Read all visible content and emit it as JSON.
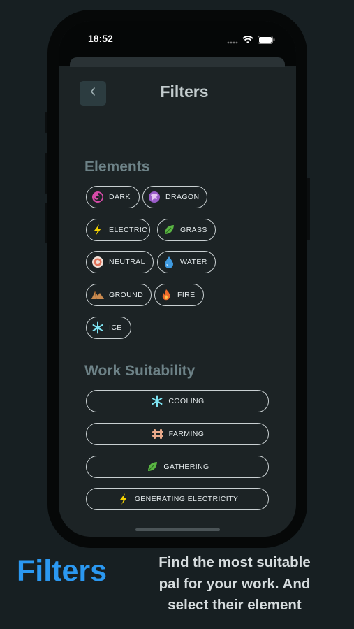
{
  "status_bar": {
    "time": "18:52"
  },
  "header": {
    "title": "Filters"
  },
  "elements": {
    "title": "Elements",
    "items": [
      {
        "label": "DARK",
        "icon": "dark-swirl-icon",
        "color": "#d64aa8"
      },
      {
        "label": "DRAGON",
        "icon": "dragon-icon",
        "color": "#9a5cc9"
      },
      {
        "label": "ELECTRIC",
        "icon": "lightning-icon",
        "color": "#f4d200"
      },
      {
        "label": "GRASS",
        "icon": "leaf-icon",
        "color": "#5ab543"
      },
      {
        "label": "NEUTRAL",
        "icon": "neutral-target-icon",
        "color": "#e8b7a8"
      },
      {
        "label": "WATER",
        "icon": "water-drop-icon",
        "color": "#3f9ae0"
      },
      {
        "label": "GROUND",
        "icon": "ground-icon",
        "color": "#c98a4f"
      },
      {
        "label": "FIRE",
        "icon": "flame-icon",
        "color": "#ef6a2b"
      },
      {
        "label": "ICE",
        "icon": "snowflake-icon",
        "color": "#7ee3f2"
      }
    ]
  },
  "work": {
    "title": "Work Suitability",
    "items": [
      {
        "label": "COOLING",
        "icon": "snowflake-icon"
      },
      {
        "label": "FARMING",
        "icon": "farming-fence-icon"
      },
      {
        "label": "GATHERING",
        "icon": "leaf-icon"
      },
      {
        "label": "GENERATING ELECTRICITY",
        "icon": "lightning-icon"
      }
    ]
  },
  "promo": {
    "title": "Filters",
    "line1": "Find the most suitable",
    "line2": "pal for your work. And",
    "line3": "select their element"
  }
}
